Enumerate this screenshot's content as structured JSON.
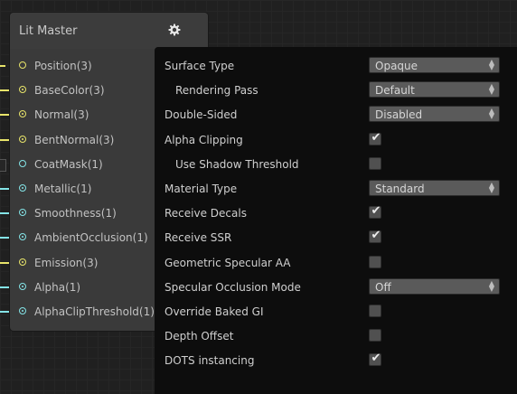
{
  "node": {
    "title": "Lit Master",
    "ports": [
      {
        "label": "Position(3)",
        "type": "vec3",
        "color": "#e8e46a"
      },
      {
        "label": "BaseColor(3)",
        "type": "vec3",
        "color": "#e8e46a"
      },
      {
        "label": "Normal(3)",
        "type": "vec3",
        "color": "#e8e46a"
      },
      {
        "label": "BentNormal(3)",
        "type": "vec3",
        "color": "#e8e46a"
      },
      {
        "label": "CoatMask(1)",
        "type": "float",
        "color": "#84e4e7"
      },
      {
        "label": "Metallic(1)",
        "type": "float",
        "color": "#84e4e7"
      },
      {
        "label": "Smoothness(1)",
        "type": "float",
        "color": "#84e4e7"
      },
      {
        "label": "AmbientOcclusion(1)",
        "type": "float",
        "color": "#84e4e7"
      },
      {
        "label": "Emission(3)",
        "type": "vec3",
        "color": "#e8e46a"
      },
      {
        "label": "Alpha(1)",
        "type": "float",
        "color": "#84e4e7"
      },
      {
        "label": "AlphaClipThreshold(1)",
        "type": "float",
        "color": "#84e4e7"
      }
    ],
    "gear_icon": "gear-icon"
  },
  "settings": {
    "rows": [
      {
        "label": "Surface Type",
        "indent": false,
        "control": "dropdown",
        "value": "Opaque"
      },
      {
        "label": "Rendering Pass",
        "indent": true,
        "control": "dropdown",
        "value": "Default"
      },
      {
        "label": "Double-Sided",
        "indent": false,
        "control": "dropdown",
        "value": "Disabled"
      },
      {
        "label": "Alpha Clipping",
        "indent": false,
        "control": "checkbox",
        "checked": true
      },
      {
        "label": "Use Shadow Threshold",
        "indent": true,
        "control": "checkbox",
        "checked": false
      },
      {
        "label": "Material Type",
        "indent": false,
        "control": "dropdown",
        "value": "Standard"
      },
      {
        "label": "Receive Decals",
        "indent": false,
        "control": "checkbox",
        "checked": true
      },
      {
        "label": "Receive SSR",
        "indent": false,
        "control": "checkbox",
        "checked": true
      },
      {
        "label": "Geometric Specular AA",
        "indent": false,
        "control": "checkbox",
        "checked": false
      },
      {
        "label": "Specular Occlusion Mode",
        "indent": false,
        "control": "dropdown",
        "value": "Off"
      },
      {
        "label": "Override Baked GI",
        "indent": false,
        "control": "checkbox",
        "checked": false
      },
      {
        "label": "Depth Offset",
        "indent": false,
        "control": "checkbox",
        "checked": false
      },
      {
        "label": "DOTS instancing",
        "indent": false,
        "control": "checkbox",
        "checked": true
      }
    ]
  },
  "colors": {
    "vec3_port": "#e8e46a",
    "float_port": "#84e4e7",
    "panel_bg": "#0d0d0d",
    "node_bg": "#3a3a3a"
  }
}
